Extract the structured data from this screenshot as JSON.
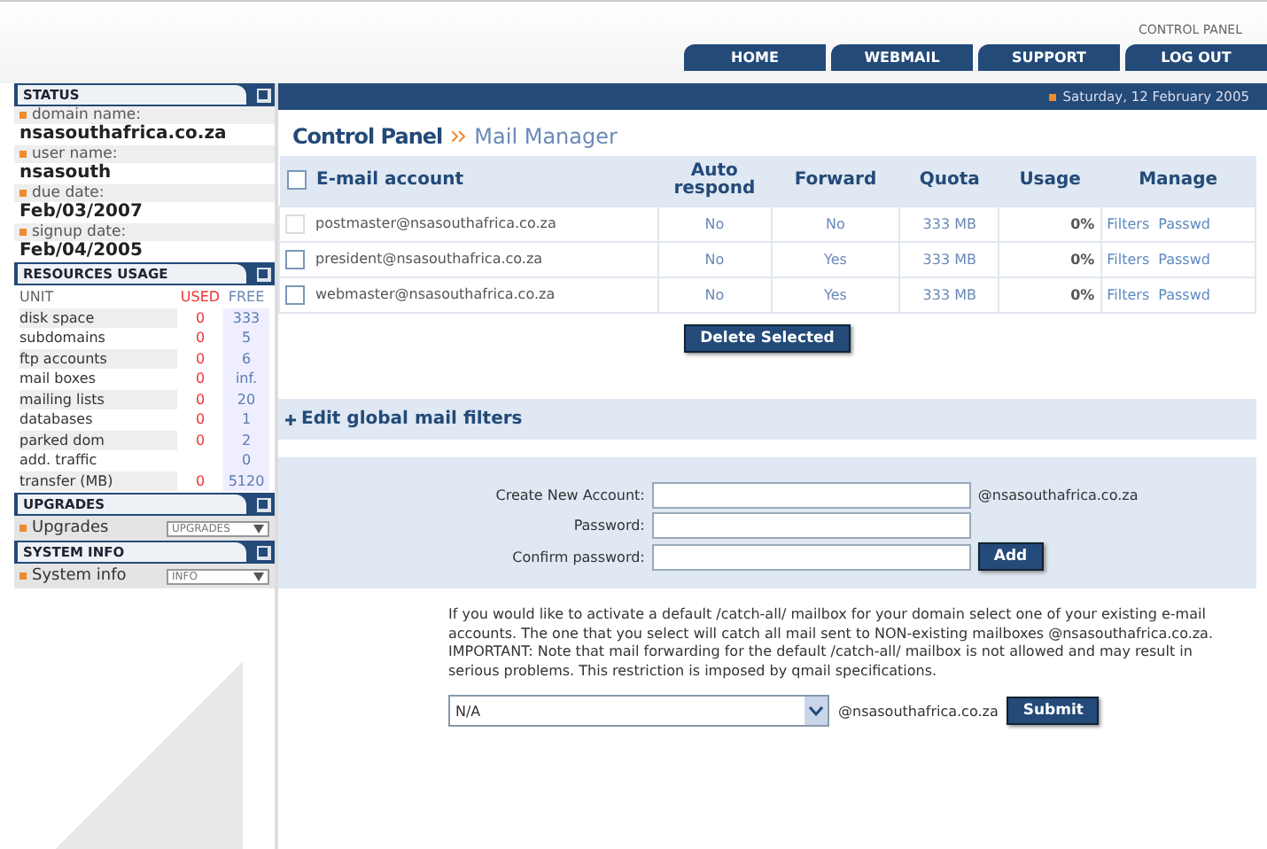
{
  "header": {
    "top_link": "CONTROL PANEL",
    "tabs": [
      "HOME",
      "WEBMAIL",
      "SUPPORT",
      "LOG OUT"
    ],
    "date": "Saturday, 12 February 2005"
  },
  "sidebar": {
    "status": {
      "title": "STATUS",
      "fields": [
        {
          "label": "domain name:",
          "value": "nsasouthafrica.co.za"
        },
        {
          "label": "user name:",
          "value": "nsasouth"
        },
        {
          "label": "due date:",
          "value": "Feb/03/2007"
        },
        {
          "label": "signup date:",
          "value": "Feb/04/2005"
        }
      ]
    },
    "resources": {
      "title": "RESOURCES USAGE",
      "columns": [
        "UNIT",
        "USED",
        "FREE"
      ],
      "rows": [
        {
          "unit": "disk space",
          "used": "0",
          "free": "333"
        },
        {
          "unit": "subdomains",
          "used": "0",
          "free": "5"
        },
        {
          "unit": "ftp accounts",
          "used": "0",
          "free": "6"
        },
        {
          "unit": "mail boxes",
          "used": "0",
          "free": "inf."
        },
        {
          "unit": "mailing lists",
          "used": "0",
          "free": "20"
        },
        {
          "unit": "databases",
          "used": "0",
          "free": "1"
        },
        {
          "unit": "parked dom",
          "used": "0",
          "free": "2"
        },
        {
          "unit": "add. traffic",
          "used": "",
          "free": "0"
        },
        {
          "unit": "transfer (MB)",
          "used": "0",
          "free": "5120"
        }
      ]
    },
    "upgrades": {
      "title": "UPGRADES",
      "label": "Upgrades",
      "select": "UPGRADES"
    },
    "system_info": {
      "title": "SYSTEM INFO",
      "label": "System info",
      "select": "INFO"
    }
  },
  "main": {
    "breadcrumb": [
      "Control Panel",
      "Mail Manager"
    ],
    "table": {
      "select_all_checked": false,
      "columns": [
        "E-mail account",
        "Auto respond",
        "Forward",
        "Quota",
        "Usage",
        "Manage"
      ],
      "rows": [
        {
          "account": "postmaster@nsasouthafrica.co.za",
          "disabled": true,
          "checked": false,
          "auto_respond": "No",
          "forward": "No",
          "quota": "333 MB",
          "usage": "0%",
          "links": [
            "Filters",
            "Passwd"
          ]
        },
        {
          "account": "president@nsasouthafrica.co.za",
          "disabled": false,
          "checked": false,
          "auto_respond": "No",
          "forward": "Yes",
          "quota": "333 MB",
          "usage": "0%",
          "links": [
            "Filters",
            "Passwd"
          ]
        },
        {
          "account": "webmaster@nsasouthafrica.co.za",
          "disabled": false,
          "checked": false,
          "auto_respond": "No",
          "forward": "Yes",
          "quota": "333 MB",
          "usage": "0%",
          "links": [
            "Filters",
            "Passwd"
          ]
        }
      ]
    },
    "delete_button": "Delete Selected",
    "filters_link": "Edit global mail filters",
    "form": {
      "fields": [
        "Create New Account:",
        "Password:",
        "Confirm password:"
      ],
      "domain": "@nsasouthafrica.co.za",
      "add_button": "Add"
    },
    "catch_all": {
      "text": "If you would like to activate a default /catch-all/ mailbox for your domain select one of your existing e-mail accounts. The one that you select will catch all mail sent to NON-existing mailboxes @nsasouthafrica.co.za.\nIMPORTANT: Note that mail forwarding for the default /catch-all/ mailbox is not allowed and may result in serious problems. This restriction is imposed by qmail specifications.",
      "select": "N/A",
      "domain": "@nsasouthafrica.co.za",
      "submit_button": "Submit"
    }
  }
}
